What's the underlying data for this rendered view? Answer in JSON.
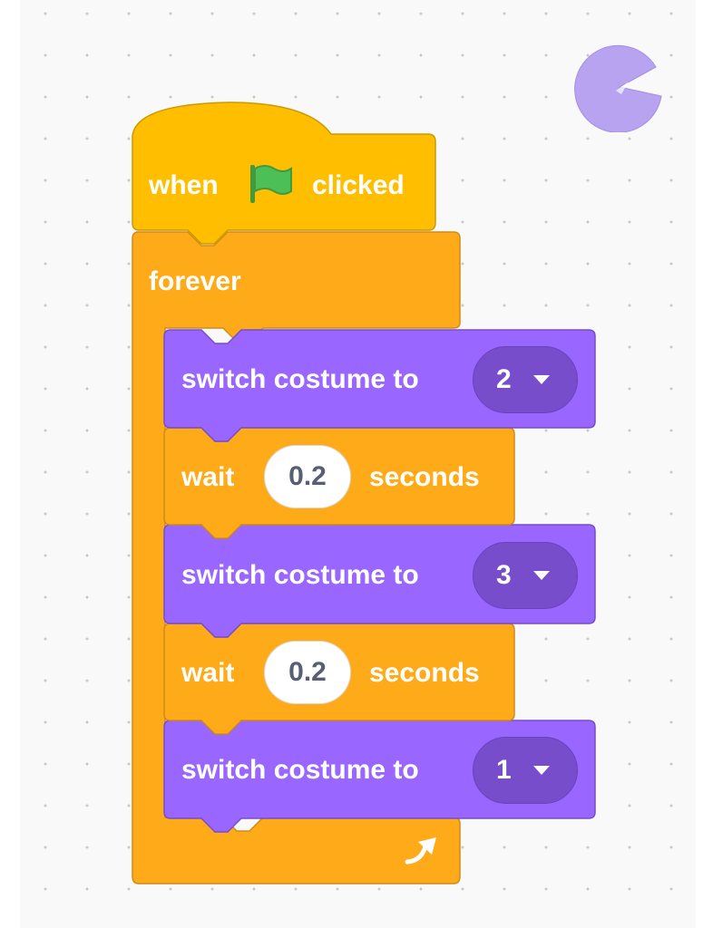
{
  "hat_block": {
    "when_label": "when",
    "flag_icon": "green-flag-icon",
    "clicked_label": "clicked",
    "color": "#ffbf00"
  },
  "forever_block": {
    "label": "forever",
    "loop_arrow_icon": "loop-arrow-icon",
    "color": "#ffab19"
  },
  "stack": [
    {
      "type": "looks",
      "label": "switch costume to",
      "value": "2"
    },
    {
      "type": "control",
      "label_before": "wait",
      "value": "0.2",
      "label_after": "seconds"
    },
    {
      "type": "looks",
      "label": "switch costume to",
      "value": "3"
    },
    {
      "type": "control",
      "label_before": "wait",
      "value": "0.2",
      "label_after": "seconds"
    },
    {
      "type": "looks",
      "label": "switch costume to",
      "value": "1"
    }
  ],
  "colors": {
    "looks": "#9966ff",
    "looks_dark": "#774dcb",
    "control": "#ffab19",
    "events": "#ffbf00",
    "workspace": "#f9f9f9"
  },
  "sprite_icon": "pacman-sprite-icon"
}
